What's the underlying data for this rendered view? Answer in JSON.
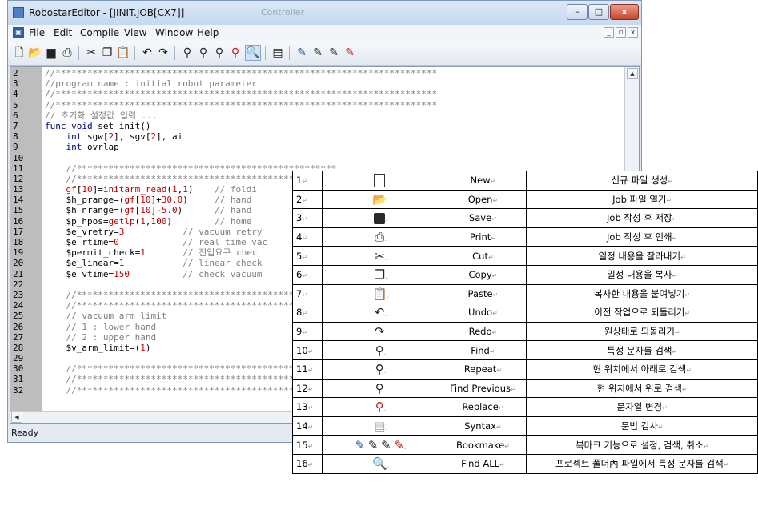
{
  "window": {
    "title": "RobostarEditor - [JINIT.JOB[CX7]]",
    "ghost_title": "Controller",
    "buttons": {
      "minimize": "–",
      "maximize": "□",
      "close": "x"
    }
  },
  "menu": {
    "items": [
      "File",
      "Edit",
      "Compile",
      "View",
      "Window",
      "Help"
    ],
    "mdi_buttons": [
      "_",
      "▫",
      "x"
    ]
  },
  "toolbar": {
    "icons": [
      "new-icon",
      "open-icon",
      "save-icon",
      "print-icon",
      "cut-icon",
      "copy-icon",
      "paste-icon",
      "undo-icon",
      "redo-icon",
      "find-icon",
      "repeat-icon",
      "find-previous-icon",
      "replace-icon",
      "find-all-icon",
      "syntax-icon",
      "bookmark-icon"
    ]
  },
  "editor": {
    "lines": [
      {
        "n": "2",
        "code": "//************************************************************************"
      },
      {
        "n": "3",
        "code": "//program name : initial robot parameter"
      },
      {
        "n": "4",
        "code": "//************************************************************************"
      },
      {
        "n": "5",
        "code": "//************************************************************************"
      },
      {
        "n": "6",
        "code": "// 초기화 설정값 입력 ..."
      },
      {
        "n": "7",
        "code": "func void set_init()"
      },
      {
        "n": "8",
        "code": "    int sgw[2], sgv[2], ai"
      },
      {
        "n": "9",
        "code": "    int ovrlap"
      },
      {
        "n": "10",
        "code": ""
      },
      {
        "n": "11",
        "code": "    //*************************************************"
      },
      {
        "n": "12",
        "code": "    //*************************************************"
      },
      {
        "n": "13",
        "code": "    gf[10]=initarm_read(1,1)    // foldi"
      },
      {
        "n": "14",
        "code": "    $h_prange=(gf[10]+30.0)     // hand"
      },
      {
        "n": "15",
        "code": "    $h_nrange=(gf[10]-5.0)      // hand"
      },
      {
        "n": "16",
        "code": "    $p_hpos=getlp(1,100)        // home"
      },
      {
        "n": "17",
        "code": "    $e_vretry=3           // vacuum retry"
      },
      {
        "n": "18",
        "code": "    $e_rtime=0            // real time vac"
      },
      {
        "n": "19",
        "code": "    $permit_check=1       // 진입요구 chec"
      },
      {
        "n": "20",
        "code": "    $e_linear=1           // linear check"
      },
      {
        "n": "21",
        "code": "    $e_vtime=150          // check vacuum"
      },
      {
        "n": "22",
        "code": ""
      },
      {
        "n": "23",
        "code": "    //*************************************************"
      },
      {
        "n": "24",
        "code": "    //*************************************************"
      },
      {
        "n": "25",
        "code": "    // vacuum arm limit"
      },
      {
        "n": "26",
        "code": "    // 1 : lower hand"
      },
      {
        "n": "27",
        "code": "    // 2 : upper hand"
      },
      {
        "n": "28",
        "code": "    $v_arm_limit=(1)"
      },
      {
        "n": "29",
        "code": ""
      },
      {
        "n": "30",
        "code": "    //*************************************************"
      },
      {
        "n": "31",
        "code": "    //*************************************************"
      },
      {
        "n": "32",
        "code": "    //*************************************************"
      }
    ]
  },
  "status": {
    "text": "Ready"
  },
  "reference_table": {
    "rows": [
      {
        "num": "1",
        "icon": "new-icon",
        "name": "New",
        "desc": "신규 파일 생성"
      },
      {
        "num": "2",
        "icon": "open-icon",
        "name": "Open",
        "desc": "Job 파일 열기"
      },
      {
        "num": "3",
        "icon": "save-icon",
        "name": "Save",
        "desc": "Job 작성 후 저장"
      },
      {
        "num": "4",
        "icon": "print-icon",
        "name": "Print",
        "desc": "Job 작성 후 인쇄"
      },
      {
        "num": "5",
        "icon": "cut-icon",
        "name": "Cut",
        "desc": "일정 내용을 잘라내기"
      },
      {
        "num": "6",
        "icon": "copy-icon",
        "name": "Copy",
        "desc": "일정 내용을 복사"
      },
      {
        "num": "7",
        "icon": "paste-icon",
        "name": "Paste",
        "desc": "복사한 내용을 붙여넣기"
      },
      {
        "num": "8",
        "icon": "undo-icon",
        "name": "Undo",
        "desc": "이전 작업으로 되돌리기"
      },
      {
        "num": "9",
        "icon": "redo-icon",
        "name": "Redo",
        "desc": "원상태로 되돌리기"
      },
      {
        "num": "10",
        "icon": "find-icon",
        "name": "Find",
        "desc": "특정 문자를 검색"
      },
      {
        "num": "11",
        "icon": "repeat-icon",
        "name": "Repeat",
        "desc": "현 위치에서 아래로 검색"
      },
      {
        "num": "12",
        "icon": "find-previous-icon",
        "name": "Find Previous",
        "desc": "현 위치에서 위로 검색"
      },
      {
        "num": "13",
        "icon": "replace-icon",
        "name": "Replace",
        "desc": "문자열 변경"
      },
      {
        "num": "14",
        "icon": "syntax-icon",
        "name": "Syntax",
        "desc": "문법 검사"
      },
      {
        "num": "15",
        "icon": "bookmark-icon",
        "name": "Bookmake",
        "desc": "북마크 기능으로 설정, 검색, 취소"
      },
      {
        "num": "16",
        "icon": "find-all-icon",
        "name": "Find ALL",
        "desc": "프로젝트 폴더內 파일에서 특정 문자를 검색"
      }
    ]
  },
  "colors": {
    "keyword": "#00008b",
    "function": "#c00000",
    "comment": "#808080",
    "gutter": "#bdbdbd",
    "accent": "#2a6bd0"
  }
}
